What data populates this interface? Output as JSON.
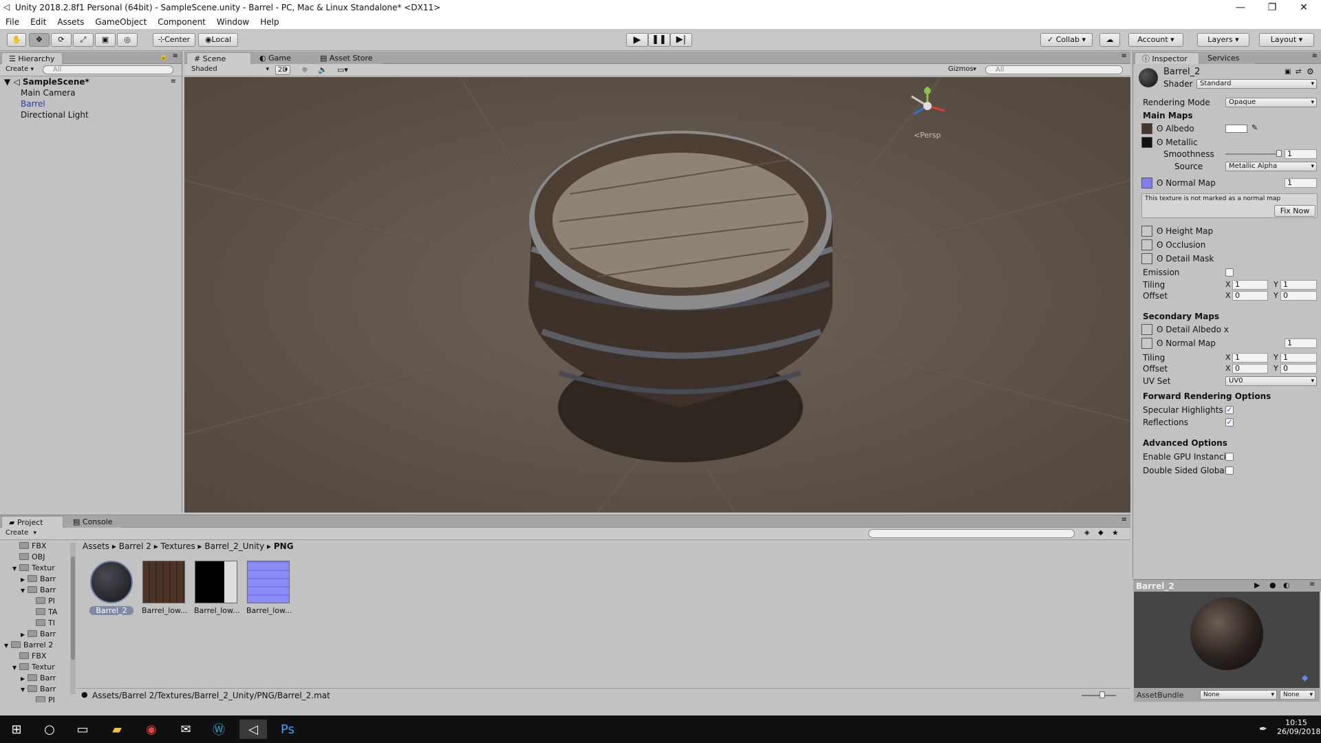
{
  "window": {
    "title": "Unity 2018.2.8f1 Personal (64bit) - SampleScene.unity - Barrel - PC, Mac & Linux Standalone* <DX11>"
  },
  "menu": [
    "File",
    "Edit",
    "Assets",
    "GameObject",
    "Component",
    "Window",
    "Help"
  ],
  "toolbar": {
    "center": "Center",
    "local": "Local",
    "collab": "Collab",
    "account": "Account",
    "layers": "Layers",
    "layout": "Layout"
  },
  "hierarchy": {
    "tab": "Hierarchy",
    "create": "Create",
    "search_placeholder": "All",
    "scene": "SampleScene*",
    "items": [
      "Main Camera",
      "Barrel",
      "Directional Light"
    ]
  },
  "scene": {
    "tabs": [
      "Scene",
      "Game",
      "Asset Store"
    ],
    "shading": "Shaded",
    "mode2d": "2D",
    "gizmos": "Gizmos",
    "search_placeholder": "All",
    "persp": "Persp"
  },
  "inspector": {
    "tabs": [
      "Inspector",
      "Services"
    ],
    "object": "Barrel_2",
    "shader_label": "Shader",
    "shader": "Standard",
    "rendering_mode_label": "Rendering Mode",
    "rendering_mode": "Opaque",
    "main_maps": "Main Maps",
    "albedo": "Albedo",
    "metallic": "Metallic",
    "smoothness": "Smoothness",
    "smoothness_value": "1",
    "source_label": "Source",
    "source": "Metallic Alpha",
    "normal_map": "Normal Map",
    "normal_value": "1",
    "warning": "This texture is not marked as a normal map",
    "fix_now": "Fix Now",
    "height_map": "Height Map",
    "occlusion": "Occlusion",
    "detail_mask": "Detail Mask",
    "emission": "Emission",
    "tiling": "Tiling",
    "offset": "Offset",
    "x": "X",
    "y": "Y",
    "tiling_x": "1",
    "tiling_y": "1",
    "offset_x": "0",
    "offset_y": "0",
    "secondary_maps": "Secondary Maps",
    "detail_albedo": "Detail Albedo x",
    "sec_normal": "Normal Map",
    "sec_normal_value": "1",
    "sec_tiling_x": "1",
    "sec_tiling_y": "1",
    "sec_offset_x": "0",
    "sec_offset_y": "0",
    "uv_set_label": "UV Set",
    "uv_set": "UV0",
    "forward": "Forward Rendering Options",
    "specular": "Specular Highlights",
    "reflections": "Reflections",
    "advanced": "Advanced Options",
    "gpu_instancing": "Enable GPU Instancii",
    "double_sided": "Double Sided Global",
    "preview_title": "Barrel_2",
    "assetbundle_label": "AssetBundle",
    "assetbundle": "None",
    "assetbundle_variant": "None"
  },
  "project": {
    "tabs": [
      "Project",
      "Console"
    ],
    "create": "Create",
    "breadcrumb": [
      "Assets",
      "Barrel 2",
      "Textures",
      "Barrel_2_Unity",
      "PNG"
    ],
    "tree": [
      {
        "label": "FBX",
        "indent": 2
      },
      {
        "label": "OBJ",
        "indent": 2
      },
      {
        "label": "Textur",
        "indent": 2,
        "arrow": "▼"
      },
      {
        "label": "Barr",
        "indent": 3,
        "arrow": "▶"
      },
      {
        "label": "Barr",
        "indent": 3,
        "arrow": "▼"
      },
      {
        "label": "PI",
        "indent": 4
      },
      {
        "label": "TA",
        "indent": 4
      },
      {
        "label": "TI",
        "indent": 4
      },
      {
        "label": "Barr",
        "indent": 3,
        "arrow": "▶"
      },
      {
        "label": "Barrel 2",
        "indent": 1,
        "arrow": "▼"
      },
      {
        "label": "FBX",
        "indent": 2
      },
      {
        "label": "Textur",
        "indent": 2,
        "arrow": "▼"
      },
      {
        "label": "Barr",
        "indent": 3,
        "arrow": "▶"
      },
      {
        "label": "Barr",
        "indent": 3,
        "arrow": "▼"
      },
      {
        "label": "PI",
        "indent": 4
      }
    ],
    "assets": [
      "Barrel_2",
      "Barrel_low...",
      "Barrel_low...",
      "Barrel_low..."
    ],
    "path": "Assets/Barrel 2/Textures/Barrel_2_Unity/PNG/Barrel_2.mat"
  },
  "taskbar": {
    "time": "10:15",
    "date": "26/09/2018"
  }
}
